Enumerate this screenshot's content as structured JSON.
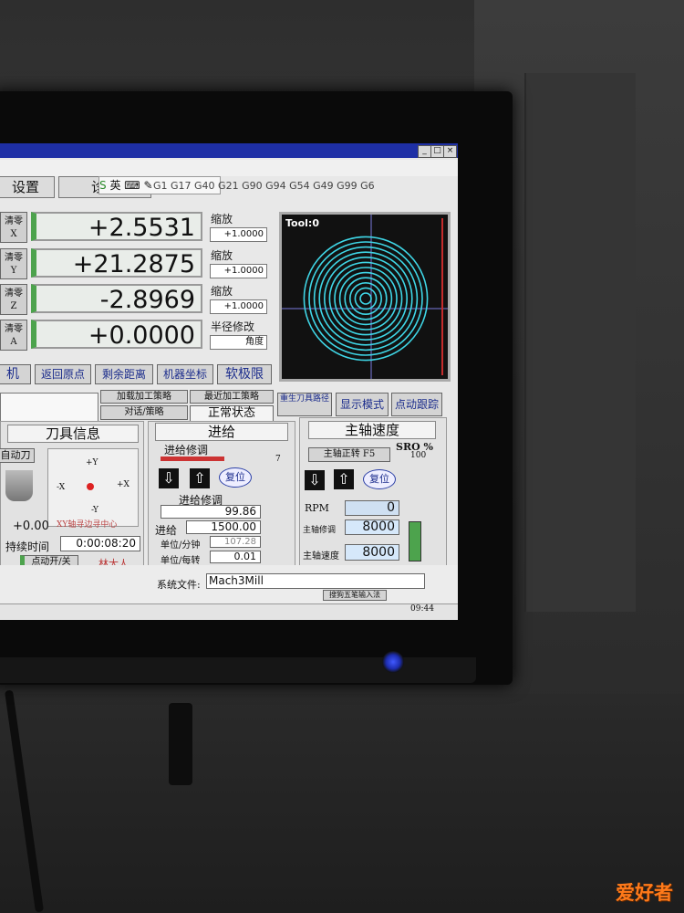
{
  "tabs": {
    "settings": "设置",
    "diagnostics": "诊断"
  },
  "ime": {
    "label": "英"
  },
  "gcode_line": "G1 G17 G40 G21 G90 G94 G54 G49 G99 G6",
  "dro": [
    {
      "btn_line1": "清零",
      "btn_line2": "X",
      "value": "+2.5531",
      "scale_label": "缩放",
      "scale_value": "+1.0000"
    },
    {
      "btn_line1": "清零",
      "btn_line2": "Y",
      "value": "+21.2875",
      "scale_label": "缩放",
      "scale_value": "+1.0000"
    },
    {
      "btn_line1": "清零",
      "btn_line2": "Z",
      "value": "-2.8969",
      "scale_label": "缩放",
      "scale_value": "+1.0000"
    },
    {
      "btn_line1": "清零",
      "btn_line2": "A",
      "value": "+0.0000",
      "scale_label": "半径修改",
      "scale_value": "角度"
    }
  ],
  "toolpath": {
    "label": "Tool:0"
  },
  "buttons": {
    "machine": "机",
    "goto_home": "返回原点",
    "dist_to_go": "剩余距离",
    "machine_coords": "机器坐标",
    "soft_limits": "软极限",
    "load_strategy": "加载加工策略",
    "recent_strategy": "最近加工策略",
    "dialog_strategy": "对话/策略",
    "status_normal": "正常状态",
    "regen_toolpath": "重生刀具路径",
    "display_mode": "显示模式",
    "jog_follow": "点动跟踪",
    "jog_onoff": "点动开/关"
  },
  "tool_panel": {
    "title": "刀具信息",
    "auto_tool": "自动刀",
    "xy_label": "XY轴寻边寻中心",
    "y_plus": "+Y",
    "x_minus": "-X",
    "x_plus": "+X",
    "y_minus": "-Y",
    "tool_offset": "+0.00",
    "duration_label": "持续时间",
    "duration_value": "0:00:08:20",
    "signature": "林大人"
  },
  "feed_panel": {
    "title": "进给",
    "override_label": "进给修调",
    "override_small": "7",
    "reset": "复位",
    "fro_label": "进给修调",
    "fro_value": "99.86",
    "feed_label": "进给",
    "feed_value": "1500.00",
    "upm_label": "单位/分钟",
    "upm_value": "107.28",
    "upr_label": "单位/每转",
    "upr_value": "0.01"
  },
  "spindle_panel": {
    "title": "主轴速度",
    "cw_button": "主轴正转 F5",
    "sro_label": "SRO %",
    "sro_value": "100",
    "reset": "复位",
    "rpm_label": "RPM",
    "rpm_value": "0",
    "override_label": "主轴修调",
    "override_value": "8000",
    "speed_label": "主轴速度",
    "speed_value": "8000"
  },
  "status": {
    "profile_label": "系统文件:",
    "profile_value": "Mach3Mill",
    "tray_ime": "搜狗五笔输入法",
    "clock": "09:44"
  },
  "watermark": "爱好者",
  "colors": {
    "accent_green": "#4da34d",
    "title_blue": "#1e2fa5",
    "toolpath_cyan": "#3fd6e6"
  }
}
